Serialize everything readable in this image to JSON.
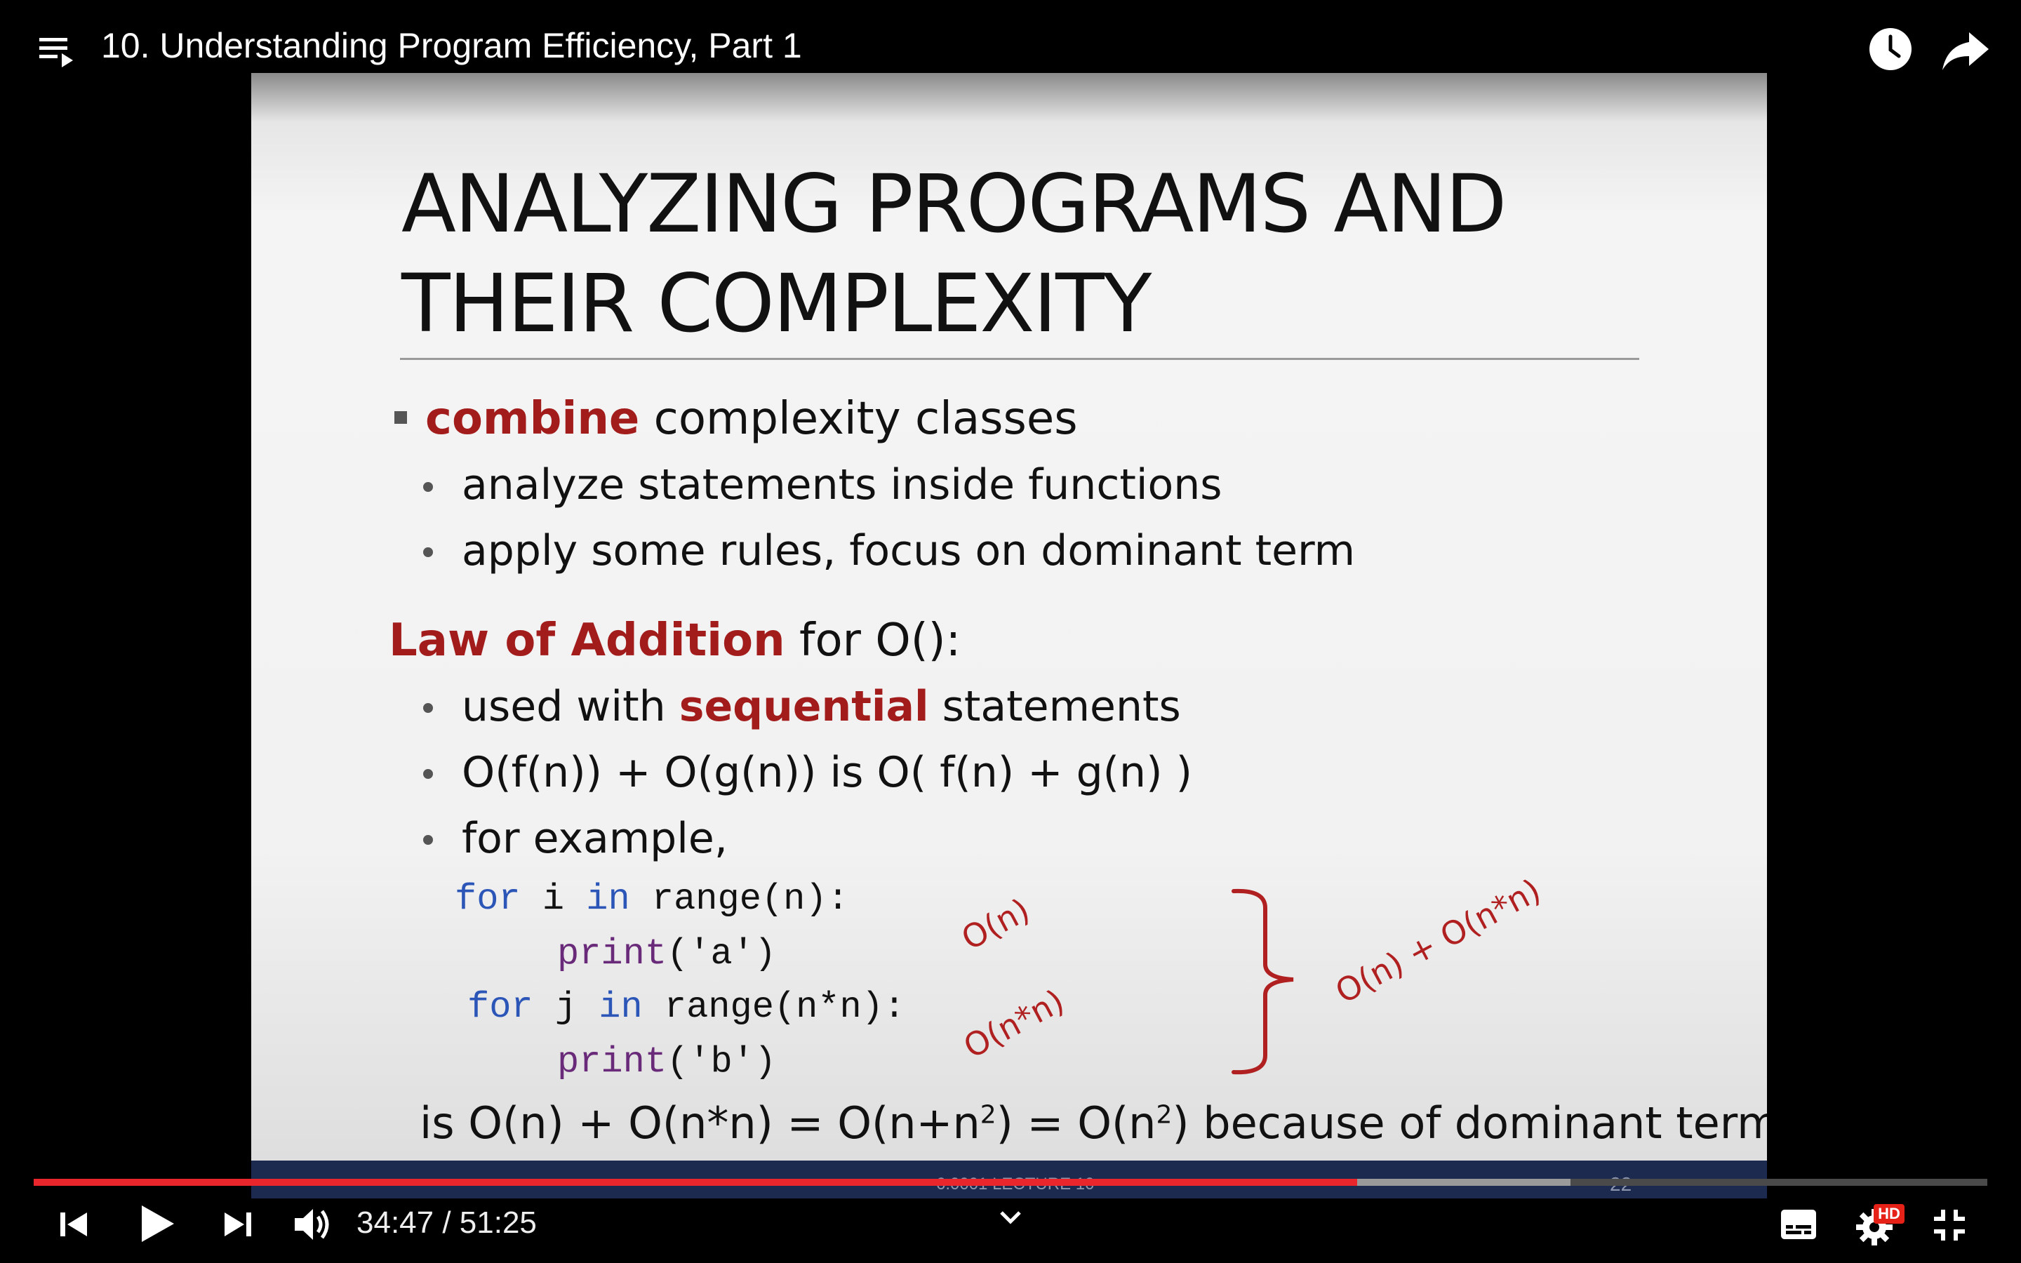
{
  "window": {
    "video_title": "10. Understanding Program Efficiency, Part 1"
  },
  "icons": {
    "playlist": "playlist-icon",
    "watch_later": "clock-icon",
    "share": "share-arrow-icon"
  },
  "slide": {
    "title_line1": "ANALYZING PROGRAMS AND",
    "title_line2": "THEIR COMPLEXITY",
    "bullet1_red": "combine",
    "bullet1_rest": " complexity classes",
    "sub1": "analyze statements inside functions",
    "sub2": "apply some rules, focus on dominant term",
    "law_red": "Law of Addition",
    "law_rest": " for O():",
    "sub3_pre": "used with ",
    "sub3_red": "sequential",
    "sub3_post": " statements",
    "sub4": "O(f(n)) + O(g(n)) is O( f(n) + g(n) )",
    "sub5": "for example,",
    "code": {
      "l1_kw1": "for",
      "l1_mid": " i ",
      "l1_kw2": "in",
      "l1_rest": " range(n):",
      "l2_fn": "print",
      "l2_rest": "('a')",
      "l3_kw1": "for",
      "l3_mid": " j ",
      "l3_kw2": "in",
      "l3_rest": " range(n*n):",
      "l4_fn": "print",
      "l4_rest": "('b')"
    },
    "annotation_on": "O(n)",
    "annotation_onn": "O(n*n)",
    "annotation_sum": "O(n) + O(n*n)",
    "conclusion_part1": "is O(n) + O(n*n) = O(n+n",
    "conclusion_sup1": "2",
    "conclusion_part2": ") = O(n",
    "conclusion_sup2": "2",
    "conclusion_part3": ") because of dominant term",
    "footer_label": "6.0001 LECTURE 10",
    "page_number": "22",
    "red_color": "#a31c1c"
  },
  "player": {
    "progress_fraction": 0.6775,
    "buffer_fraction": 0.7865,
    "current_time": "34:47",
    "separator": " / ",
    "duration": "51:25",
    "hd_badge": "HD",
    "icons": [
      "skip-previous-icon",
      "play-icon",
      "skip-next-icon",
      "volume-icon",
      "chevron-down-icon",
      "subtitles-icon",
      "settings-icon",
      "exit-fullscreen-icon"
    ]
  }
}
